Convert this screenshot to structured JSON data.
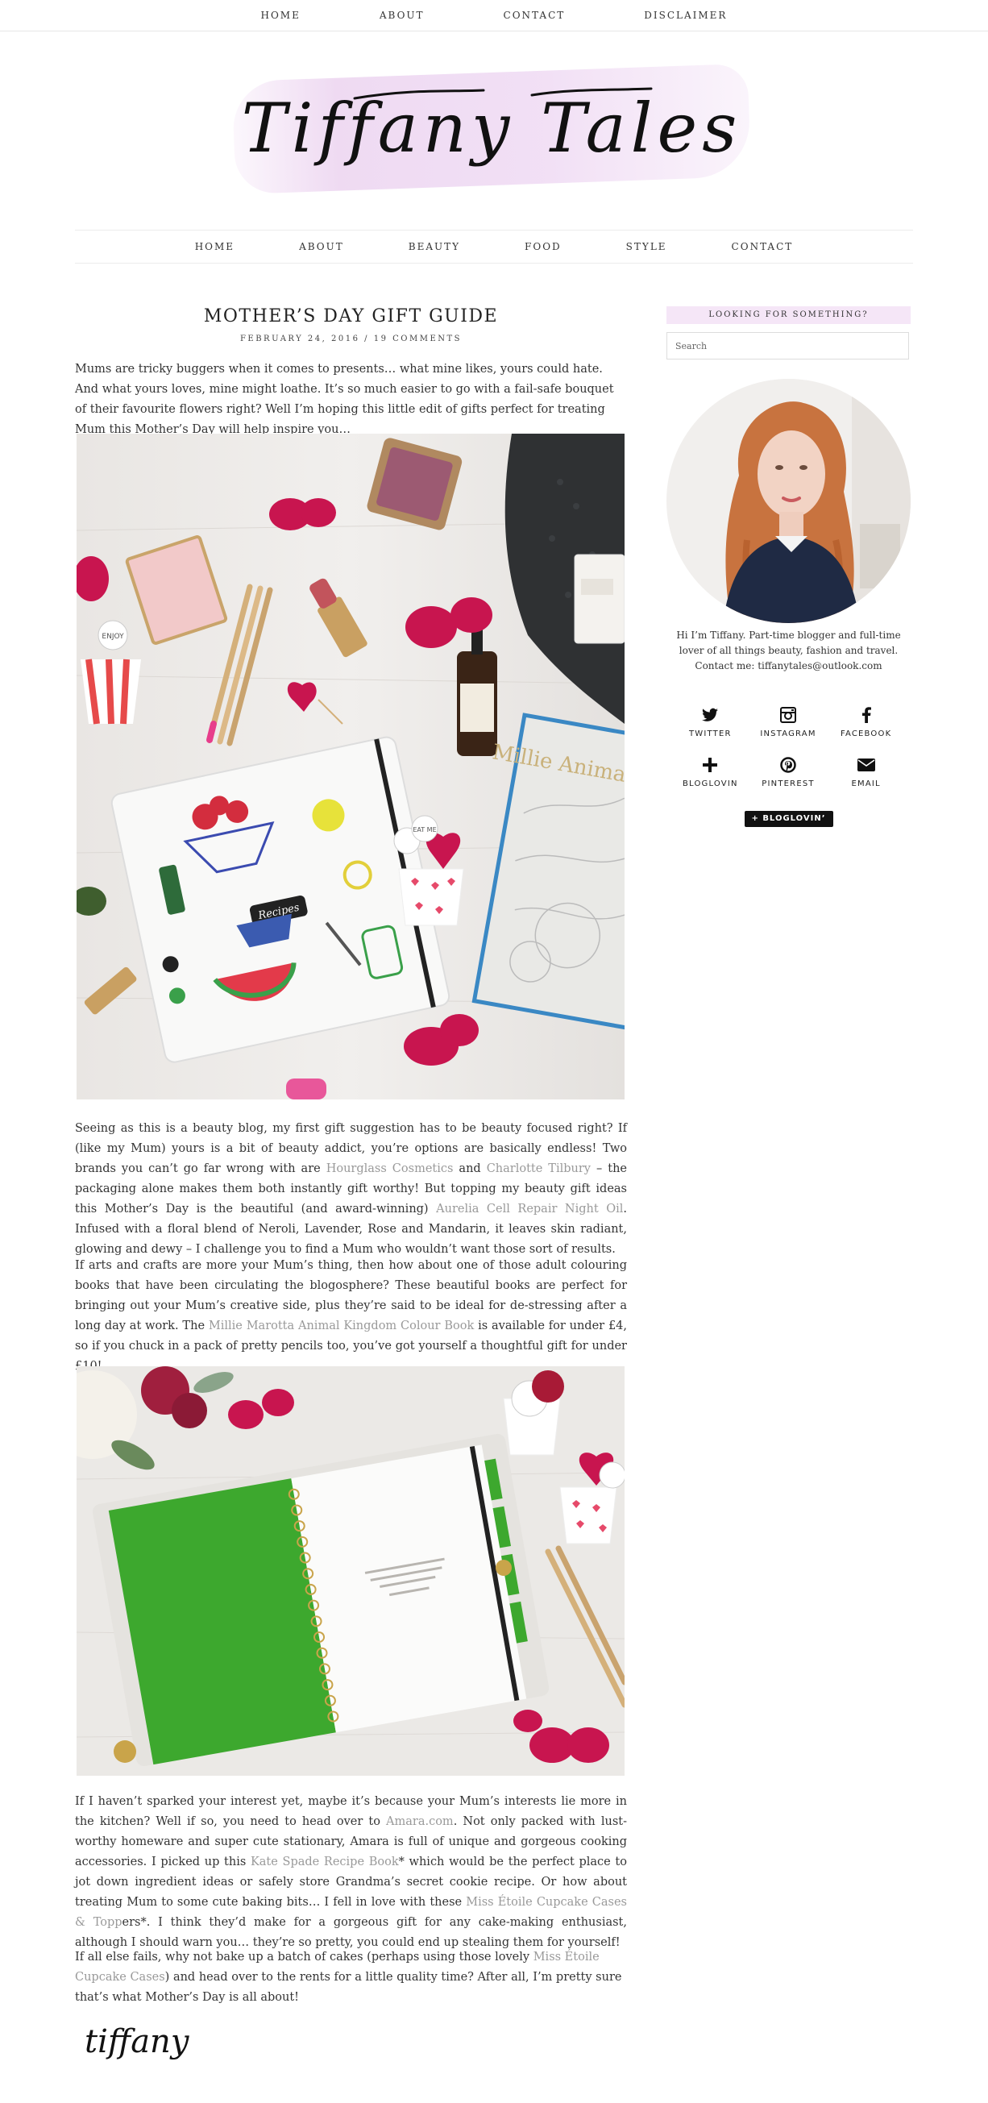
{
  "topnav": {
    "items": [
      {
        "label": "HOME"
      },
      {
        "label": "ABOUT"
      },
      {
        "label": "CONTACT"
      },
      {
        "label": "DISCLAIMER"
      }
    ]
  },
  "header": {
    "logo_text": "Tiffany Tales"
  },
  "mainnav": {
    "items": [
      {
        "label": "HOME"
      },
      {
        "label": "ABOUT"
      },
      {
        "label": "BEAUTY"
      },
      {
        "label": "FOOD"
      },
      {
        "label": "STYLE"
      },
      {
        "label": "CONTACT"
      }
    ]
  },
  "post": {
    "title": "MOTHER’S DAY GIFT GUIDE",
    "date": "FEBRUARY 24, 2016",
    "meta_separator": "/",
    "comments": "19 COMMENTS",
    "p1": "Mums are tricky buggers when it comes to presents… what mine likes, yours could hate. And what yours loves, mine might loathe. It’s so much easier to go with a fail-safe bouquet of their favourite flowers right? Well I’m hoping this little edit of gifts perfect for treating Mum this Mother’s Day will help inspire you…",
    "p2": {
      "t1": "Seeing as this is a beauty blog, my first gift suggestion has to be beauty focused right? If (like my Mum) yours is a bit of beauty addict, you’re options are basically endless! Two brands you can’t go far wrong with are ",
      "l1": "Hourglass Cosmetics",
      "t2": " and ",
      "l2": "Charlotte Tilbury",
      "t3": " – the packaging alone makes them both instantly gift worthy! But topping my beauty gift ideas this Mother’s Day is the beautiful (and award-winning) ",
      "l3": "Aurelia Cell Repair Night Oil",
      "t4": ". Infused with a floral blend of Neroli, Lavender, Rose and Mandarin, it leaves skin radiant, glowing and dewy – I challenge you to find a Mum who wouldn’t want those sort of results."
    },
    "p3": {
      "t1": "If arts and crafts are more your Mum’s thing, then how about one of those adult colouring books that have been circulating the blogosphere? These beautiful books are perfect for bringing out your Mum’s creative side, plus they’re said to be ideal for de-stressing after a long day at work. The ",
      "l1": "Millie Marotta Animal Kingdom Colour Book",
      "t2": " is available for under £4, so if you chuck in a pack of pretty pencils too, you’ve got yourself a thoughtful gift for under £10!"
    },
    "p4": {
      "t1": "If I haven’t sparked your interest yet, maybe it’s because your Mum’s interests lie more in the kitchen? Well if so, you need to head over to ",
      "l1": "Amara.com",
      "t2": ".  Not only packed with lust-worthy homeware and super cute stationary, Amara is full of unique and gorgeous cooking accessories. I picked up this ",
      "l2": "Kate Spade Recipe Book",
      "t3": "* which would be the perfect place to jot down ingredient ideas or safely store Grandma’s secret cookie recipe. Or how about treating Mum to some cute baking bits… I fell in love with these ",
      "l3": "Miss Étoile Cupcake Cases & Topp",
      "t4": "ers*. I think they’d make for a gorgeous gift for any cake-making enthusiast, although I should warn you… they’re so pretty, you could end up stealing them for yourself!"
    },
    "p5": {
      "t1": "If all else fails, why not bake up a batch of cakes (perhaps using those lovely ",
      "l1": "Miss Étoile Cupcake Cases",
      "t2": ") and head over to the rents for a little quality time? After all, I’m pretty sure that’s what Mother’s Day is all about!"
    },
    "signature": "tiffany",
    "image1_book_label": "Recipes",
    "image1_book2_title": "Millie Animal Kingdom",
    "image1_badge_text": "ENJOY",
    "image1_badge2_text": "EAT ME"
  },
  "sidebar": {
    "search_heading": "LOOKING FOR SOMETHING?",
    "search_placeholder": "Search",
    "bio": "Hi I’m Tiffany. Part-time blogger and full-time lover of all things beauty, fashion and travel. Contact me: tiffanytales@outlook.com",
    "social": [
      {
        "label": "TWITTER",
        "icon": "twitter-icon"
      },
      {
        "label": "INSTAGRAM",
        "icon": "instagram-icon"
      },
      {
        "label": "FACEBOOK",
        "icon": "facebook-icon"
      },
      {
        "label": "BLOGLOVIN",
        "icon": "plus-icon"
      },
      {
        "label": "PINTEREST",
        "icon": "pinterest-icon"
      },
      {
        "label": "EMAIL",
        "icon": "envelope-icon"
      }
    ],
    "bloglovin_button": "+ BLOGLOVIN’"
  },
  "colors": {
    "accent_pink": "#f5e6f7",
    "link_grey": "#999999",
    "rose_red": "#c8154f",
    "notebook_green": "#3da82e"
  }
}
